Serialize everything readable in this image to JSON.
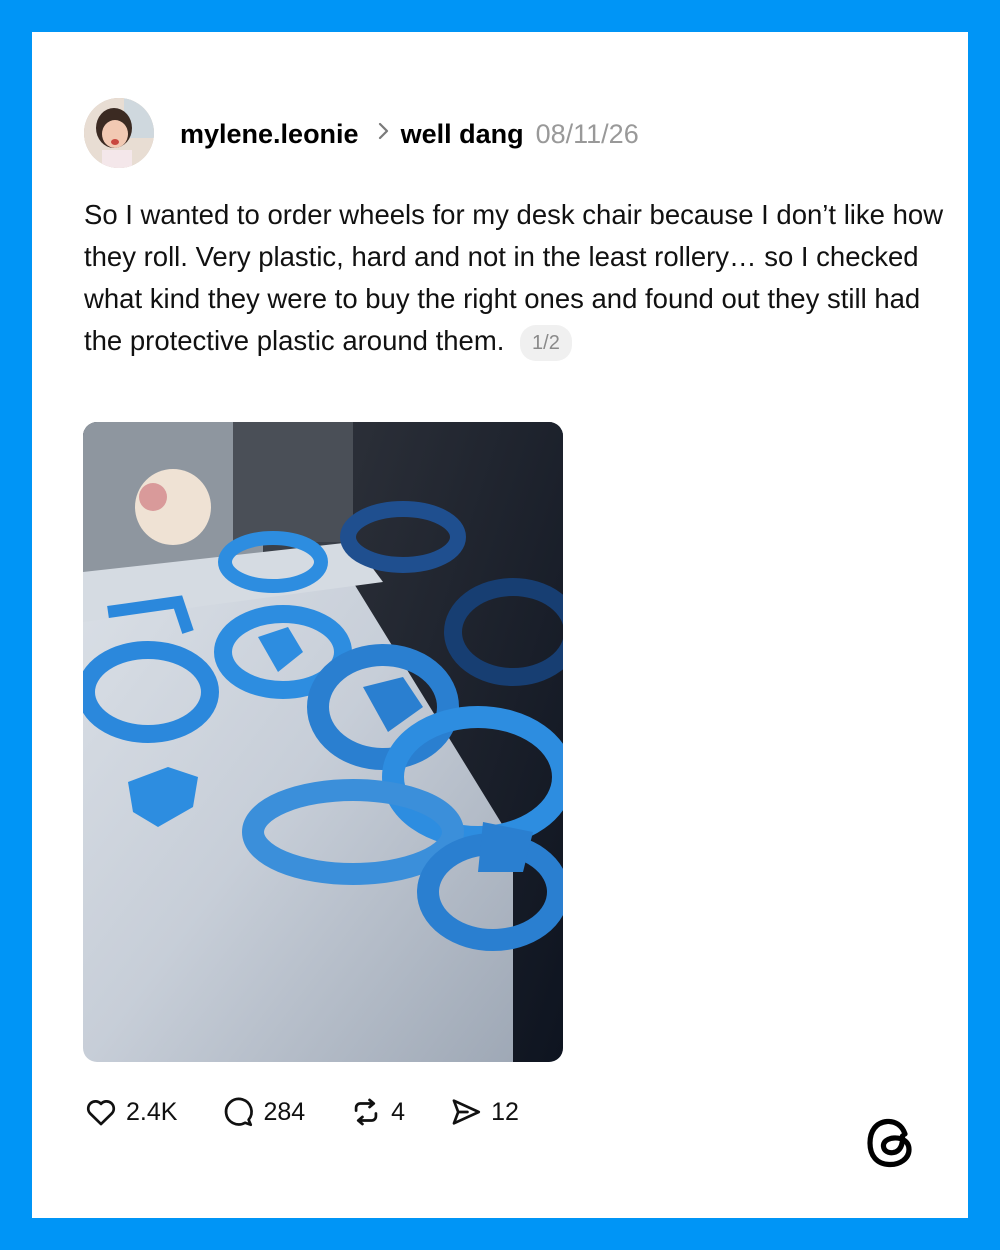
{
  "post": {
    "username": "mylene.leonie",
    "separator": ">",
    "topic": "well dang",
    "date": "08/11/26",
    "text": "So I wanted to order wheels for my desk chair because I don’t like how they roll. Very plastic, hard and not in the least rollery… so I checked what kind they were to buy the right ones and found out they still had the protective plastic around them.",
    "page_indicator": "1/2"
  },
  "actions": {
    "likes": "2.4K",
    "comments": "284",
    "reposts": "4",
    "shares": "12"
  },
  "icons": {
    "like": "heart-icon",
    "comment": "comment-bubble-icon",
    "repost": "repost-icon",
    "share": "send-icon",
    "brand": "threads-logo-icon"
  },
  "colors": {
    "frame": "#0095F6",
    "card": "#ffffff",
    "date_text": "#999999",
    "wheel_blue": "#2d8de0"
  }
}
